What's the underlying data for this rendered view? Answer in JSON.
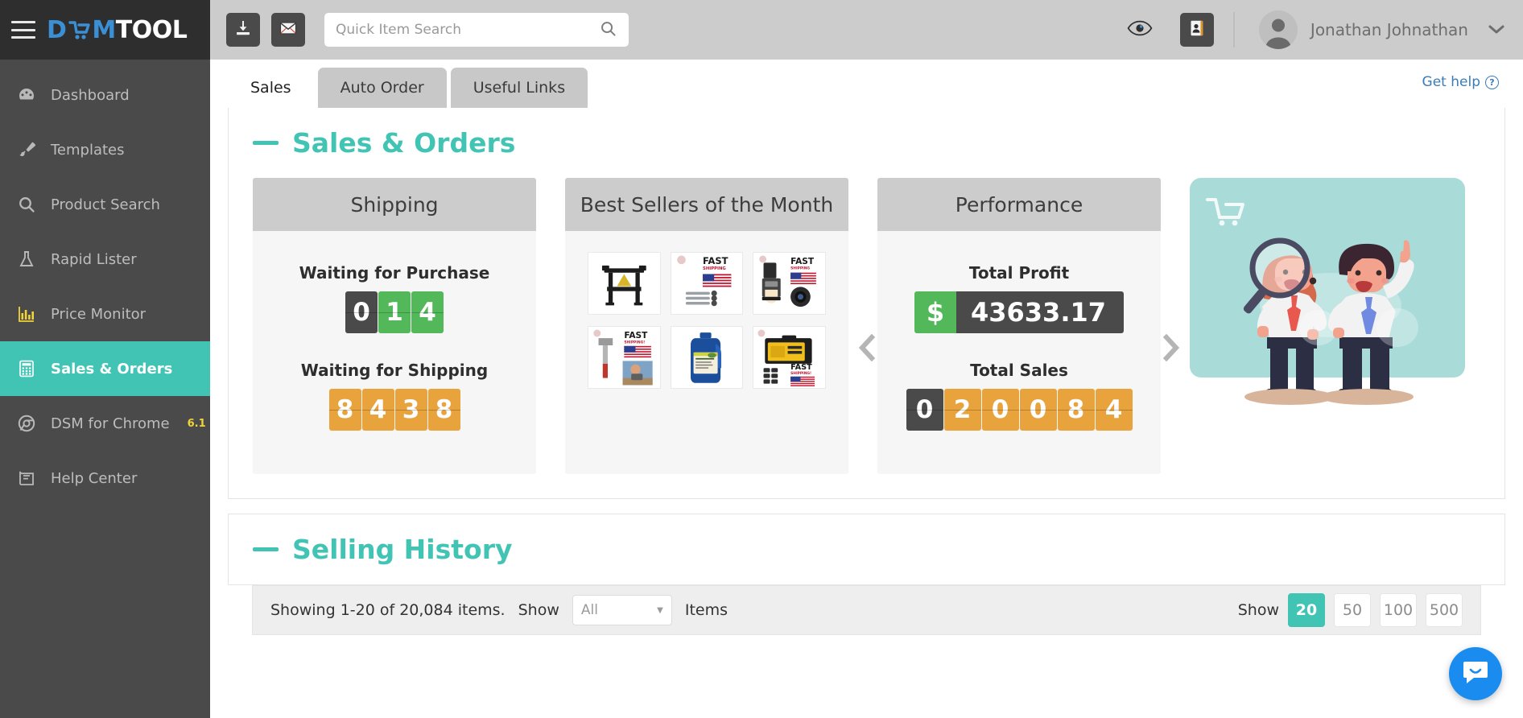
{
  "brand": {
    "logo_d": "D",
    "logo_m": "M",
    "logo_tool": "TOOL",
    "logo_full": "DSMTOOL"
  },
  "sidebar": {
    "items": [
      {
        "label": "Dashboard",
        "icon": "dashboard-icon",
        "active": false,
        "badge": ""
      },
      {
        "label": "Templates",
        "icon": "brush-icon",
        "active": false,
        "badge": ""
      },
      {
        "label": "Product Search",
        "icon": "search-icon",
        "active": false,
        "badge": ""
      },
      {
        "label": "Rapid Lister",
        "icon": "flask-icon",
        "active": false,
        "badge": ""
      },
      {
        "label": "Price Monitor",
        "icon": "bar-chart-icon",
        "active": false,
        "badge": ""
      },
      {
        "label": "Sales & Orders",
        "icon": "calculator-icon",
        "active": true,
        "badge": ""
      },
      {
        "label": "DSM for Chrome",
        "icon": "chrome-icon",
        "active": false,
        "badge": "6.1"
      },
      {
        "label": "Help Center",
        "icon": "book-icon",
        "active": false,
        "badge": ""
      }
    ]
  },
  "topbar": {
    "download_icon": "download-icon",
    "mail_icon": "envelope-icon",
    "eye_icon": "eye-icon",
    "contacts_icon": "address-book-icon",
    "search": {
      "value": "",
      "placeholder": "Quick Item Search",
      "icon": "search-icon"
    },
    "user": {
      "name": "Jonathan Johnathan",
      "avatar": "user-avatar",
      "caret": "chevron-down-icon"
    }
  },
  "tabs": [
    {
      "label": "Sales",
      "active": true
    },
    {
      "label": "Auto Order",
      "active": false
    },
    {
      "label": "Useful Links",
      "active": false
    }
  ],
  "get_help": {
    "label": "Get help",
    "icon": "question-circle-icon"
  },
  "sections": {
    "sales_orders": {
      "title": "Sales & Orders"
    },
    "selling_history": {
      "title": "Selling History"
    }
  },
  "shipping_card": {
    "title": "Shipping",
    "waiting_purchase": {
      "label": "Waiting for Purchase",
      "value": "014",
      "digits": [
        {
          "d": "0",
          "color": "dark"
        },
        {
          "d": "1",
          "color": "green"
        },
        {
          "d": "4",
          "color": "green"
        }
      ]
    },
    "waiting_shipping": {
      "label": "Waiting for Shipping",
      "value": "8438",
      "digits": [
        {
          "d": "8",
          "color": "orange"
        },
        {
          "d": "4",
          "color": "orange"
        },
        {
          "d": "3",
          "color": "orange"
        },
        {
          "d": "8",
          "color": "orange"
        }
      ]
    }
  },
  "best_sellers_card": {
    "title": "Best Sellers of the Month",
    "items": [
      {
        "name": "sawhorse-product",
        "badge": ""
      },
      {
        "name": "drill-bits-product",
        "badge": "FREE FAST SHIPPING"
      },
      {
        "name": "coffee-maker-product",
        "badge": "FREE FAST SHIPPING"
      },
      {
        "name": "hammer-product",
        "badge": "FREE FAST SHIPPING"
      },
      {
        "name": "cleaner-bottle-product",
        "badge": ""
      },
      {
        "name": "tool-case-product",
        "badge": "FREE FAST SHIPPING"
      }
    ]
  },
  "performance_card": {
    "title": "Performance",
    "total_profit": {
      "label": "Total Profit",
      "currency": "$",
      "value": "43633.17"
    },
    "total_sales": {
      "label": "Total Sales",
      "value": "020084",
      "digits": [
        {
          "d": "0",
          "color": "dark"
        },
        {
          "d": "2",
          "color": "orange"
        },
        {
          "d": "0",
          "color": "orange"
        },
        {
          "d": "0",
          "color": "orange"
        },
        {
          "d": "8",
          "color": "orange"
        },
        {
          "d": "4",
          "color": "orange"
        }
      ]
    },
    "prev_arrow": "chevron-left-icon",
    "next_arrow": "chevron-right-icon"
  },
  "illustration": {
    "name": "shopping-team-illustration",
    "cart_icon": "cart-icon"
  },
  "selling_history": {
    "showing_text": "Showing 1-20 of 20,084 items.",
    "show_label": "Show",
    "items_label": "Items",
    "filter_select": {
      "value": "All",
      "options": [
        "All"
      ]
    },
    "page_size_label": "Show",
    "page_sizes": [
      {
        "label": "20",
        "active": true
      },
      {
        "label": "50",
        "active": false
      },
      {
        "label": "100",
        "active": false
      },
      {
        "label": "500",
        "active": false
      }
    ]
  },
  "intercom": {
    "icon": "chat-bubble-icon"
  },
  "colors": {
    "accent_teal": "#42c4b5",
    "sidebar_bg": "#4a4a4a",
    "sidebar_dark": "#2e2e2e",
    "topbar_bg": "#cccccc",
    "green": "#52b85a",
    "orange": "#e8a33d",
    "dark_digit": "#4a4a4a",
    "link_blue": "#3b7cb8",
    "intercom_blue": "#1a8cf0",
    "version_badge": "#f0d43a"
  }
}
